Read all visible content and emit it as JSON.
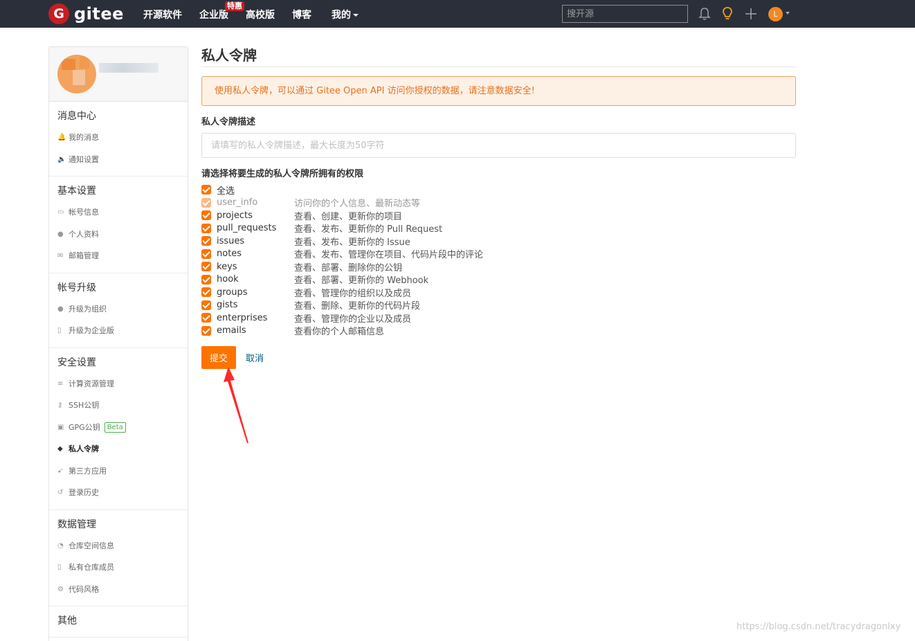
{
  "header": {
    "logo_glyph": "G",
    "logo_text": "gitee",
    "nav": [
      "开源软件",
      "企业版",
      "高校版",
      "博客",
      "我的"
    ],
    "hot_badge": "特惠",
    "search_placeholder": "搜开源",
    "user_initial": "L"
  },
  "sidebar": {
    "groups": [
      {
        "title": "消息中心",
        "items": [
          {
            "label": "我的消息",
            "icon": "bell-icon"
          },
          {
            "label": "通知设置",
            "icon": "volume-icon"
          }
        ]
      },
      {
        "title": "基本设置",
        "items": [
          {
            "label": "帐号信息",
            "icon": "id-card-icon"
          },
          {
            "label": "个人资料",
            "icon": "user-icon"
          },
          {
            "label": "邮箱管理",
            "icon": "mail-icon"
          }
        ]
      },
      {
        "title": "帐号升级",
        "items": [
          {
            "label": "升级为组织",
            "icon": "group-icon"
          },
          {
            "label": "升级为企业版",
            "icon": "building-icon"
          }
        ]
      },
      {
        "title": "安全设置",
        "items": [
          {
            "label": "计算资源管理",
            "icon": "list-icon"
          },
          {
            "label": "SSH公钥",
            "icon": "key-icon"
          },
          {
            "label": "GPG公钥",
            "icon": "lock-icon",
            "badge": "Beta"
          },
          {
            "label": "私人令牌",
            "icon": "spy-icon",
            "active": true
          },
          {
            "label": "第三方应用",
            "icon": "rocket-icon"
          },
          {
            "label": "登录历史",
            "icon": "history-icon"
          }
        ]
      },
      {
        "title": "数据管理",
        "items": [
          {
            "label": "仓库空间信息",
            "icon": "pie-icon"
          },
          {
            "label": "私有仓库成员",
            "icon": "book-icon"
          },
          {
            "label": "代码风格",
            "icon": "cogs-icon"
          }
        ]
      },
      {
        "title": "其他",
        "items": []
      }
    ]
  },
  "main": {
    "title": "私人令牌",
    "notice": "使用私人令牌，可以通过 Gitee Open API 访问你授权的数据，请注意数据安全!",
    "desc_label": "私人令牌描述",
    "desc_placeholder": "请填写的私人令牌描述，最大长度为50字符",
    "perm_label": "请选择将要生成的私人令牌所拥有的权限",
    "select_all": "全选",
    "permissions": [
      {
        "name": "user_info",
        "desc": "访问你的个人信息、最新动态等",
        "disabled": true
      },
      {
        "name": "projects",
        "desc": "查看、创建、更新你的项目"
      },
      {
        "name": "pull_requests",
        "desc": "查看、发布、更新你的 Pull Request"
      },
      {
        "name": "issues",
        "desc": "查看、发布、更新你的 Issue"
      },
      {
        "name": "notes",
        "desc": "查看、发布、管理你在项目、代码片段中的评论"
      },
      {
        "name": "keys",
        "desc": "查看、部署、删除你的公钥"
      },
      {
        "name": "hook",
        "desc": "查看、部署、更新你的 Webhook"
      },
      {
        "name": "groups",
        "desc": "查看、管理你的组织以及成员"
      },
      {
        "name": "gists",
        "desc": "查看、删除、更新你的代码片段"
      },
      {
        "name": "enterprises",
        "desc": "查看、管理你的企业以及成员"
      },
      {
        "name": "emails",
        "desc": "查看你的个人邮箱信息"
      }
    ],
    "submit_label": "提交",
    "cancel_label": "取消"
  },
  "watermark": "https://blog.csdn.net/tracydragonlxy",
  "colors": {
    "accent": "#fe7300",
    "topbar": "#2b2f3a",
    "brand": "#c71d23",
    "annotation_arrow": "#ff2a2a"
  }
}
